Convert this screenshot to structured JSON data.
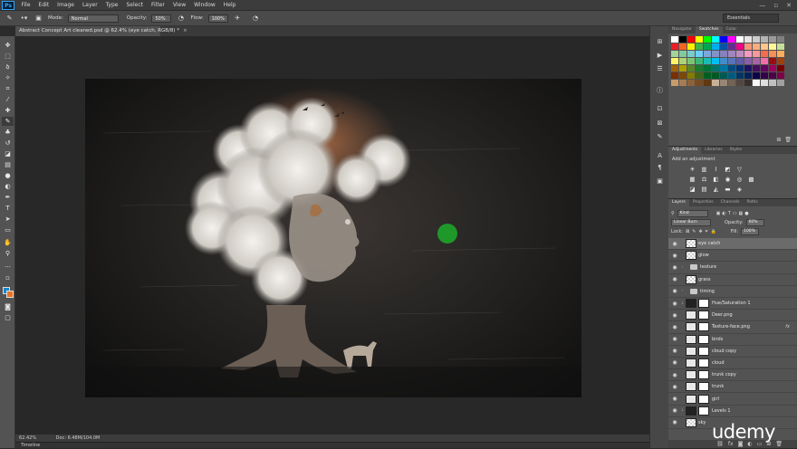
{
  "app": {
    "logo": "Ps"
  },
  "menu": [
    "File",
    "Edit",
    "Image",
    "Layer",
    "Type",
    "Select",
    "Filter",
    "View",
    "Window",
    "Help"
  ],
  "window_controls": [
    "—",
    "▫",
    "✕"
  ],
  "options": {
    "mode_label": "Mode:",
    "mode_value": "Normal",
    "opacity_label": "Opacity:",
    "opacity_value": "50%",
    "flow_label": "Flow:",
    "flow_value": "100%"
  },
  "workspace": "Essentials",
  "document_tab": {
    "title": "Abstract Concept Art cleaned.psd @ 62.4% (eye catch, RGB/8) *",
    "close": "×"
  },
  "status": {
    "zoom": "62.42%",
    "doc": "Doc: 6.48M/104.0M"
  },
  "timeline_label": "Timeline",
  "swatches_tabs": [
    "Navigator",
    "Swatches",
    "Color"
  ],
  "swatches_active": 1,
  "swatch_colors": [
    "#ffffff",
    "#000000",
    "#ff0000",
    "#ffff00",
    "#00ff00",
    "#00ffff",
    "#0000ff",
    "#ff00ff",
    "#ffffff",
    "#e6e6e6",
    "#cccccc",
    "#b3b3b3",
    "#999999",
    "#808080",
    "#ed1c24",
    "#f26522",
    "#fff200",
    "#39b54a",
    "#00a651",
    "#00aeef",
    "#0054a6",
    "#662d91",
    "#ec008c",
    "#f7977a",
    "#f9ad81",
    "#fdc68a",
    "#fff79a",
    "#c4df9b",
    "#a3d39c",
    "#82ca9d",
    "#7accc8",
    "#6dcff6",
    "#7da7d9",
    "#8393ca",
    "#8781bd",
    "#a186be",
    "#bd8cbf",
    "#f49ac2",
    "#f5989d",
    "#f26c4f",
    "#f68e56",
    "#fbaf5d",
    "#fff568",
    "#acd373",
    "#7cc576",
    "#3bb878",
    "#1abbb4",
    "#00bff3",
    "#438ccb",
    "#5574b9",
    "#605ca8",
    "#855fa8",
    "#a763a8",
    "#f06eaa",
    "#9e0b0f",
    "#a0410d",
    "#a36209",
    "#aba000",
    "#598527",
    "#197b30",
    "#007236",
    "#00746b",
    "#0076a3",
    "#004b80",
    "#003471",
    "#1b1464",
    "#440e62",
    "#630460",
    "#9e005d",
    "#790000",
    "#7b2e00",
    "#7d4900",
    "#827b00",
    "#406618",
    "#005e20",
    "#005826",
    "#005952",
    "#005b7f",
    "#003663",
    "#002157",
    "#0d004c",
    "#32004b",
    "#4b0049",
    "#7b0046",
    "#c69c6d",
    "#a67c52",
    "#8c6239",
    "#754c24",
    "#603913",
    "#c7b299",
    "#998675",
    "#736357",
    "#534741",
    "#37302d",
    "#f7f7f7",
    "#e0e0e0",
    "#c0c0c0",
    "#a0a0a0"
  ],
  "adjustments": {
    "tabs": [
      "Adjustments",
      "Libraries",
      "Styles"
    ],
    "title": "Add an adjustment"
  },
  "layers_panel": {
    "tabs": [
      "Layers",
      "Properties",
      "Channels",
      "Paths"
    ],
    "kind": "Kind",
    "blend": "Linear Burn",
    "opacity_label": "Opacity:",
    "opacity": "60%",
    "lock_label": "Lock:",
    "fill_label": "Fill:",
    "fill": "100%"
  },
  "layers": [
    {
      "name": "eye catch",
      "type": "pixel",
      "selected": true
    },
    {
      "name": "glow",
      "type": "pixel"
    },
    {
      "name": "texture",
      "type": "group"
    },
    {
      "name": "grass",
      "type": "pixel"
    },
    {
      "name": "timing",
      "type": "group"
    },
    {
      "name": "Hue/Saturation 1",
      "type": "adjust"
    },
    {
      "name": "Deer.png",
      "type": "masked"
    },
    {
      "name": "Texture-face.png",
      "type": "masked",
      "fx": "fx"
    },
    {
      "name": "birds",
      "type": "masked"
    },
    {
      "name": "cloud copy",
      "type": "masked"
    },
    {
      "name": "cloud",
      "type": "masked"
    },
    {
      "name": "trunk copy",
      "type": "masked"
    },
    {
      "name": "trunk",
      "type": "masked"
    },
    {
      "name": "girl",
      "type": "masked"
    },
    {
      "name": "Levels 1",
      "type": "adjust"
    },
    {
      "name": "sky",
      "type": "pixel"
    }
  ],
  "watermark": "udemy"
}
